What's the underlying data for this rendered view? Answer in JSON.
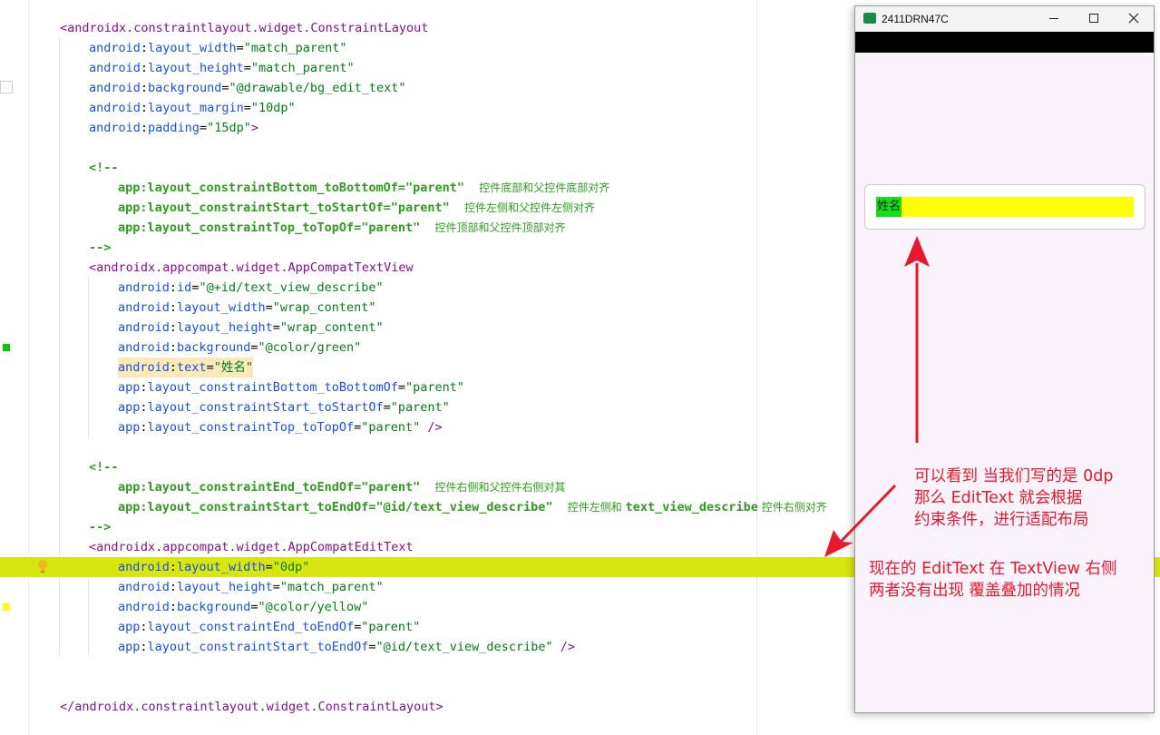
{
  "editor": {
    "lines": [
      {
        "ind": 0,
        "parts": [
          {
            "c": "tg",
            "t": "<androidx.constraintlayout.widget.ConstraintLayout"
          }
        ]
      },
      {
        "ind": 1,
        "parts": [
          {
            "c": "ns",
            "t": "android"
          },
          {
            "c": "pu",
            "t": ":"
          },
          {
            "c": "at",
            "t": "layout_width"
          },
          {
            "c": "pu",
            "t": "="
          },
          {
            "c": "av",
            "t": "\"match_parent\""
          }
        ]
      },
      {
        "ind": 1,
        "parts": [
          {
            "c": "ns",
            "t": "android"
          },
          {
            "c": "pu",
            "t": ":"
          },
          {
            "c": "at",
            "t": "layout_height"
          },
          {
            "c": "pu",
            "t": "="
          },
          {
            "c": "av",
            "t": "\"match_parent\""
          }
        ]
      },
      {
        "ind": 1,
        "parts": [
          {
            "c": "ns",
            "t": "android"
          },
          {
            "c": "pu",
            "t": ":"
          },
          {
            "c": "at",
            "t": "background"
          },
          {
            "c": "pu",
            "t": "="
          },
          {
            "c": "av",
            "t": "\"@drawable/bg_edit_text\""
          }
        ]
      },
      {
        "ind": 1,
        "parts": [
          {
            "c": "ns",
            "t": "android"
          },
          {
            "c": "pu",
            "t": ":"
          },
          {
            "c": "at",
            "t": "layout_margin"
          },
          {
            "c": "pu",
            "t": "="
          },
          {
            "c": "av",
            "t": "\"10dp\""
          }
        ]
      },
      {
        "ind": 1,
        "parts": [
          {
            "c": "ns",
            "t": "android"
          },
          {
            "c": "pu",
            "t": ":"
          },
          {
            "c": "at",
            "t": "padding"
          },
          {
            "c": "pu",
            "t": "="
          },
          {
            "c": "av",
            "t": "\"15dp\""
          },
          {
            "c": "tg",
            "t": ">"
          }
        ]
      },
      {
        "ind": 1,
        "parts": []
      },
      {
        "ind": 1,
        "parts": [
          {
            "c": "cm",
            "t": "<!--"
          }
        ]
      },
      {
        "ind": 2,
        "parts": [
          {
            "c": "cm",
            "t": "app:layout_constraintBottom_toBottomOf=\"parent\"  "
          },
          {
            "c": "cc",
            "t": "控件底部和父控件底部对齐"
          }
        ]
      },
      {
        "ind": 2,
        "parts": [
          {
            "c": "cm",
            "t": "app:layout_constraintStart_toStartOf=\"parent\"  "
          },
          {
            "c": "cc",
            "t": "控件左侧和父控件左侧对齐"
          }
        ]
      },
      {
        "ind": 2,
        "parts": [
          {
            "c": "cm",
            "t": "app:layout_constraintTop_toTopOf=\"parent\"  "
          },
          {
            "c": "cc",
            "t": "控件顶部和父控件顶部对齐"
          }
        ]
      },
      {
        "ind": 1,
        "parts": [
          {
            "c": "cm",
            "t": "-->"
          }
        ]
      },
      {
        "ind": 1,
        "parts": [
          {
            "c": "tg",
            "t": "<androidx.appcompat.widget.AppCompatTextView"
          }
        ]
      },
      {
        "ind": 2,
        "parts": [
          {
            "c": "ns",
            "t": "android"
          },
          {
            "c": "pu",
            "t": ":"
          },
          {
            "c": "at",
            "t": "id"
          },
          {
            "c": "pu",
            "t": "="
          },
          {
            "c": "av",
            "t": "\"@+id/text_view_describe\""
          }
        ]
      },
      {
        "ind": 2,
        "parts": [
          {
            "c": "ns",
            "t": "android"
          },
          {
            "c": "pu",
            "t": ":"
          },
          {
            "c": "at",
            "t": "layout_width"
          },
          {
            "c": "pu",
            "t": "="
          },
          {
            "c": "av",
            "t": "\"wrap_content\""
          }
        ]
      },
      {
        "ind": 2,
        "parts": [
          {
            "c": "ns",
            "t": "android"
          },
          {
            "c": "pu",
            "t": ":"
          },
          {
            "c": "at",
            "t": "layout_height"
          },
          {
            "c": "pu",
            "t": "="
          },
          {
            "c": "av",
            "t": "\"wrap_content\""
          }
        ]
      },
      {
        "ind": 2,
        "parts": [
          {
            "c": "ns",
            "t": "android"
          },
          {
            "c": "pu",
            "t": ":"
          },
          {
            "c": "at",
            "t": "background"
          },
          {
            "c": "pu",
            "t": "="
          },
          {
            "c": "av",
            "t": "\"@color/green\""
          }
        ]
      },
      {
        "ind": 2,
        "hl": "text",
        "parts": [
          {
            "c": "ns",
            "t": "android"
          },
          {
            "c": "pu",
            "t": ":"
          },
          {
            "c": "at",
            "t": "text"
          },
          {
            "c": "pu",
            "t": "="
          },
          {
            "c": "av",
            "t": "\"姓名\""
          }
        ]
      },
      {
        "ind": 2,
        "parts": [
          {
            "c": "ns",
            "t": "app"
          },
          {
            "c": "pu",
            "t": ":"
          },
          {
            "c": "at",
            "t": "layout_constraintBottom_toBottomOf"
          },
          {
            "c": "pu",
            "t": "="
          },
          {
            "c": "av",
            "t": "\"parent\""
          }
        ]
      },
      {
        "ind": 2,
        "parts": [
          {
            "c": "ns",
            "t": "app"
          },
          {
            "c": "pu",
            "t": ":"
          },
          {
            "c": "at",
            "t": "layout_constraintStart_toStartOf"
          },
          {
            "c": "pu",
            "t": "="
          },
          {
            "c": "av",
            "t": "\"parent\""
          }
        ]
      },
      {
        "ind": 2,
        "parts": [
          {
            "c": "ns",
            "t": "app"
          },
          {
            "c": "pu",
            "t": ":"
          },
          {
            "c": "at",
            "t": "layout_constraintTop_toTopOf"
          },
          {
            "c": "pu",
            "t": "="
          },
          {
            "c": "av",
            "t": "\"parent\""
          },
          {
            "c": "tg",
            "t": " />"
          }
        ]
      },
      {
        "ind": 1,
        "parts": []
      },
      {
        "ind": 1,
        "parts": [
          {
            "c": "cm",
            "t": "<!--"
          }
        ]
      },
      {
        "ind": 2,
        "parts": [
          {
            "c": "cm",
            "t": "app:layout_constraintEnd_toEndOf=\"parent\"  "
          },
          {
            "c": "cc",
            "t": "控件右侧和父控件右侧对其"
          }
        ]
      },
      {
        "ind": 2,
        "parts": [
          {
            "c": "cm",
            "t": "app:layout_constraintStart_toEndOf=\"@id/text_view_describe\"  "
          },
          {
            "c": "cc",
            "t": "控件左侧和 "
          },
          {
            "c": "cm",
            "t": "text_view_describe"
          },
          {
            "c": "cc",
            "t": " 控件右侧对齐"
          }
        ]
      },
      {
        "ind": 1,
        "parts": [
          {
            "c": "cm",
            "t": "-->"
          }
        ]
      },
      {
        "ind": 1,
        "parts": [
          {
            "c": "tg",
            "t": "<androidx.appcompat.widget.AppCompatEditText"
          }
        ]
      },
      {
        "ind": 2,
        "hl": "line",
        "parts": [
          {
            "c": "ns",
            "t": "android"
          },
          {
            "c": "pu",
            "t": ":"
          },
          {
            "c": "at",
            "t": "layout_width"
          },
          {
            "c": "pu",
            "t": "="
          },
          {
            "c": "av",
            "t": "\"0dp\""
          }
        ]
      },
      {
        "ind": 2,
        "parts": [
          {
            "c": "ns",
            "t": "android"
          },
          {
            "c": "pu",
            "t": ":"
          },
          {
            "c": "at",
            "t": "layout_height"
          },
          {
            "c": "pu",
            "t": "="
          },
          {
            "c": "av",
            "t": "\"match_parent\""
          }
        ]
      },
      {
        "ind": 2,
        "parts": [
          {
            "c": "ns",
            "t": "android"
          },
          {
            "c": "pu",
            "t": ":"
          },
          {
            "c": "at",
            "t": "background"
          },
          {
            "c": "pu",
            "t": "="
          },
          {
            "c": "av",
            "t": "\"@color/yellow\""
          }
        ]
      },
      {
        "ind": 2,
        "parts": [
          {
            "c": "ns",
            "t": "app"
          },
          {
            "c": "pu",
            "t": ":"
          },
          {
            "c": "at",
            "t": "layout_constraintEnd_toEndOf"
          },
          {
            "c": "pu",
            "t": "="
          },
          {
            "c": "av",
            "t": "\"parent\""
          }
        ]
      },
      {
        "ind": 2,
        "parts": [
          {
            "c": "ns",
            "t": "app"
          },
          {
            "c": "pu",
            "t": ":"
          },
          {
            "c": "at",
            "t": "layout_constraintStart_toEndOf"
          },
          {
            "c": "pu",
            "t": "="
          },
          {
            "c": "av",
            "t": "\"@id/text_view_describe\""
          },
          {
            "c": "tg",
            "t": " />"
          }
        ]
      },
      {
        "ind": 0,
        "parts": []
      },
      {
        "ind": 0,
        "parts": []
      },
      {
        "ind": 0,
        "parts": [
          {
            "c": "tg",
            "t": "</androidx.constraintlayout.widget.ConstraintLayout>"
          }
        ]
      }
    ],
    "gutter": {
      "green_swatch_color": "#00cc00",
      "yellow_swatch_color": "#ffff00",
      "bulb_icon": "lightbulb-icon"
    }
  },
  "emulator": {
    "title": "2411DRN47C",
    "icons": {
      "app": "android-emulator-icon",
      "minimize": "minimize-icon",
      "maximize": "maximize-icon",
      "close": "close-icon"
    },
    "text_view_text": "姓名",
    "colors": {
      "text_view_bg": "#14e114",
      "edit_text_bg": "#ffff00",
      "screen_bg": "#fbf3fb"
    }
  },
  "annotations": {
    "note_top": "可以看到 当我们写的是 0dp\n那么 EditText 就会根据\n约束条件，进行适配布局",
    "note_bottom": "现在的 EditText 在 TextView 右侧\n两者没有出现 覆盖叠加的情况",
    "color": "#e8192c"
  }
}
